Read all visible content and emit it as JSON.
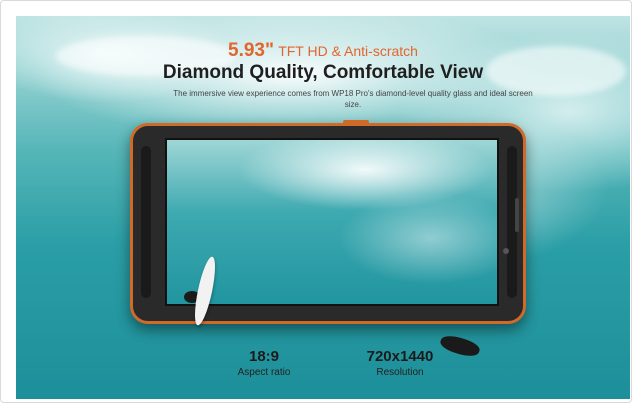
{
  "headline": {
    "size": "5.93\"",
    "size_rest": "TFT HD & Anti-scratch",
    "title": "Diamond Quality, Comfortable View",
    "description": "The immersive view experience comes from WP18 Pro's diamond-level quality glass and ideal screen size."
  },
  "specs": [
    {
      "value": "18:9",
      "label": "Aspect ratio"
    },
    {
      "value": "720x1440",
      "label": "Resolution"
    }
  ],
  "colors": {
    "accent": "#e3652b",
    "frame": "#d06a28",
    "sea": "#2a9ea6"
  }
}
